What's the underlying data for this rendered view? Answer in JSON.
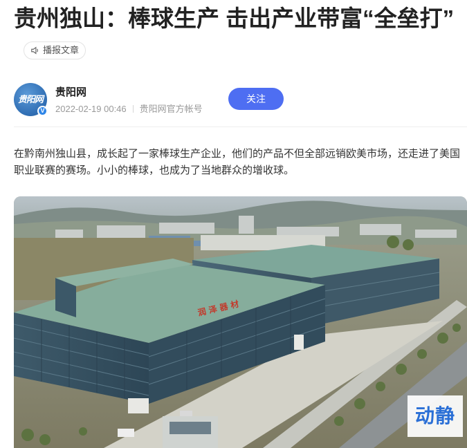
{
  "article": {
    "title": "贵州独山：棒球生产 击出产业带富“全垒打”",
    "listen_label": "播报文章",
    "body": "在黔南州独山县，成长起了一家棒球生产企业，他们的产品不但全部远销欧美市场，还走进了美国职业联赛的赛场。小小的棒球，也成为了当地群众的增收球。"
  },
  "author": {
    "avatar_text": "贵阳网",
    "verified_mark": "V",
    "name": "贵阳网",
    "date": "2022-02-19 00:46",
    "account_type": "贵阳网官方帐号",
    "follow_label": "关注"
  },
  "photo": {
    "sign_text": "润 泽 器 材",
    "watermark": "动静"
  },
  "icons": {
    "listen": "speaker-icon",
    "verified": "verified-badge-icon"
  },
  "colors": {
    "accent": "#4e6ef2",
    "title": "#222222",
    "meta": "#999999",
    "verified": "#2f86e8",
    "watermark": "#2a6fd6"
  }
}
